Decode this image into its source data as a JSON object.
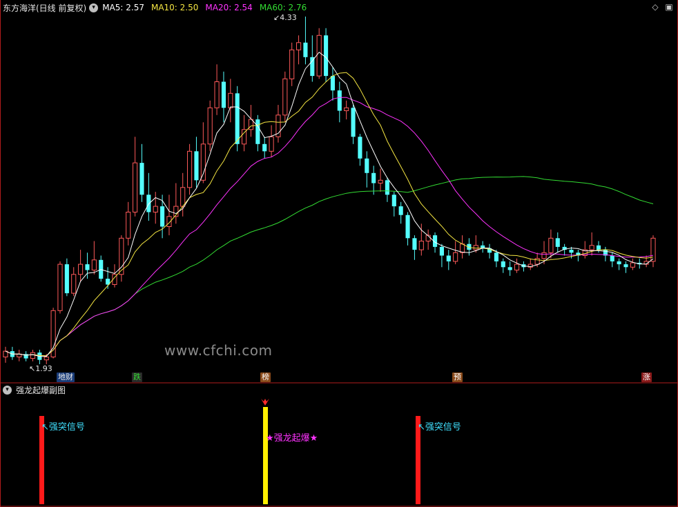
{
  "header": {
    "title": "东方海洋(日线 前复权)",
    "ma_items": [
      {
        "label": "MA5: 2.57",
        "color": "#ffffff"
      },
      {
        "label": "MA10: 2.50",
        "color": "#f5e642"
      },
      {
        "label": "MA20: 2.54",
        "color": "#ff33ff"
      },
      {
        "label": "MA60: 2.76",
        "color": "#33dd33"
      }
    ]
  },
  "top_icons": [
    "diamond-icon",
    "square-icon"
  ],
  "price_labels": {
    "high": "4.33",
    "low": "1.93"
  },
  "watermark": "www.cfchi.com",
  "event_tags": [
    {
      "text": "地财",
      "color": "#e8e8e8",
      "bg": "#1a3d7a"
    },
    {
      "text": "跌",
      "color": "#33dd33",
      "bg": "#2a2a2a"
    },
    {
      "text": "榜",
      "color": "#ffffff",
      "bg": "#8a4a1a"
    },
    {
      "text": "预",
      "color": "#ffffff",
      "bg": "#8a4a1a"
    },
    {
      "text": "涨",
      "color": "#ffffff",
      "bg": "#8a1a1a"
    }
  ],
  "sub_panel": {
    "title": "强龙起爆副图",
    "signals": [
      {
        "label": "↖强突信号",
        "color": "#ff1a1a",
        "label_color": "#40e0ff"
      },
      {
        "label": "★强龙起爆★",
        "color": "#ffee00",
        "label_color": "#ff33ff"
      },
      {
        "label": "↖强突信号",
        "color": "#ff1a1a",
        "label_color": "#40e0ff"
      }
    ]
  },
  "colors": {
    "up": "#ff5a5a",
    "down": "#54ffff",
    "ma5": "#ffffff",
    "ma10": "#f5e642",
    "ma20": "#ff33ff",
    "ma60": "#33dd33",
    "divider": "#b21c1c"
  },
  "chart_data": {
    "type": "candlestick",
    "price_max": 4.33,
    "price_min": 1.93,
    "candles": [
      [
        1.98,
        2.02,
        2.05,
        1.94
      ],
      [
        2.02,
        1.98,
        2.05,
        1.96
      ],
      [
        1.98,
        2.0,
        2.03,
        1.95
      ],
      [
        2.0,
        1.97,
        2.02,
        1.95
      ],
      [
        1.97,
        2.01,
        2.03,
        1.95
      ],
      [
        2.01,
        1.96,
        2.03,
        1.93
      ],
      [
        1.96,
        1.98,
        2.0,
        1.93
      ],
      [
        1.98,
        2.3,
        2.32,
        1.97
      ],
      [
        2.3,
        2.62,
        2.64,
        2.28
      ],
      [
        2.62,
        2.42,
        2.66,
        2.4
      ],
      [
        2.42,
        2.55,
        2.6,
        2.4
      ],
      [
        2.55,
        2.62,
        2.72,
        2.5
      ],
      [
        2.62,
        2.58,
        2.7,
        2.52
      ],
      [
        2.58,
        2.65,
        2.78,
        2.55
      ],
      [
        2.65,
        2.52,
        2.68,
        2.5
      ],
      [
        2.52,
        2.48,
        2.6,
        2.45
      ],
      [
        2.48,
        2.55,
        2.62,
        2.46
      ],
      [
        2.55,
        2.8,
        2.82,
        2.5
      ],
      [
        2.8,
        2.98,
        3.05,
        2.75
      ],
      [
        2.98,
        3.32,
        3.5,
        2.95
      ],
      [
        3.32,
        3.1,
        3.45,
        3.05
      ],
      [
        3.1,
        2.98,
        3.25,
        2.92
      ],
      [
        2.98,
        3.02,
        3.12,
        2.9
      ],
      [
        3.02,
        2.88,
        3.1,
        2.8
      ],
      [
        2.88,
        2.95,
        3.1,
        2.82
      ],
      [
        2.95,
        3.02,
        3.18,
        2.9
      ],
      [
        3.02,
        3.15,
        3.25,
        2.95
      ],
      [
        3.15,
        3.4,
        3.45,
        3.1
      ],
      [
        3.4,
        3.2,
        3.5,
        3.15
      ],
      [
        3.2,
        3.45,
        3.6,
        3.18
      ],
      [
        3.45,
        3.7,
        3.75,
        3.4
      ],
      [
        3.7,
        3.88,
        4.0,
        3.65
      ],
      [
        3.88,
        3.7,
        3.95,
        3.6
      ],
      [
        3.7,
        3.8,
        3.9,
        3.6
      ],
      [
        3.8,
        3.45,
        3.85,
        3.4
      ],
      [
        3.45,
        3.55,
        3.65,
        3.4
      ],
      [
        3.55,
        3.62,
        3.72,
        3.5
      ],
      [
        3.62,
        3.45,
        3.65,
        3.4
      ],
      [
        3.45,
        3.4,
        3.5,
        3.35
      ],
      [
        3.4,
        3.5,
        3.58,
        3.36
      ],
      [
        3.5,
        3.65,
        3.72,
        3.46
      ],
      [
        3.65,
        3.9,
        3.95,
        3.6
      ],
      [
        3.9,
        4.1,
        4.15,
        3.85
      ],
      [
        4.1,
        4.15,
        4.2,
        4.0
      ],
      [
        4.15,
        4.05,
        4.33,
        4.0
      ],
      [
        4.05,
        3.92,
        4.2,
        3.88
      ],
      [
        3.92,
        4.2,
        4.25,
        3.9
      ],
      [
        4.2,
        3.92,
        4.25,
        3.88
      ],
      [
        3.92,
        3.82,
        3.98,
        3.75
      ],
      [
        3.82,
        3.68,
        3.88,
        3.6
      ],
      [
        3.68,
        3.7,
        3.75,
        3.62
      ],
      [
        3.7,
        3.5,
        3.72,
        3.45
      ],
      [
        3.5,
        3.35,
        3.52,
        3.3
      ],
      [
        3.35,
        3.25,
        3.4,
        3.15
      ],
      [
        3.25,
        3.18,
        3.3,
        3.1
      ],
      [
        3.18,
        3.2,
        3.28,
        3.12
      ],
      [
        3.2,
        3.1,
        3.22,
        3.05
      ],
      [
        3.1,
        3.02,
        3.12,
        2.95
      ],
      [
        3.02,
        2.96,
        3.05,
        2.9
      ],
      [
        2.96,
        2.8,
        2.98,
        2.75
      ],
      [
        2.8,
        2.72,
        2.82,
        2.65
      ],
      [
        2.72,
        2.78,
        2.9,
        2.68
      ],
      [
        2.78,
        2.82,
        2.86,
        2.72
      ],
      [
        2.82,
        2.74,
        2.84,
        2.7
      ],
      [
        2.74,
        2.68,
        2.76,
        2.6
      ],
      [
        2.68,
        2.64,
        2.72,
        2.58
      ],
      [
        2.64,
        2.7,
        2.78,
        2.62
      ],
      [
        2.7,
        2.76,
        2.82,
        2.66
      ],
      [
        2.76,
        2.72,
        2.8,
        2.68
      ],
      [
        2.72,
        2.75,
        2.82,
        2.7
      ],
      [
        2.75,
        2.73,
        2.78,
        2.7
      ],
      [
        2.73,
        2.7,
        2.76,
        2.66
      ],
      [
        2.7,
        2.64,
        2.72,
        2.6
      ],
      [
        2.64,
        2.6,
        2.66,
        2.56
      ],
      [
        2.6,
        2.58,
        2.64,
        2.54
      ],
      [
        2.58,
        2.62,
        2.66,
        2.56
      ],
      [
        2.62,
        2.6,
        2.64,
        2.57
      ],
      [
        2.6,
        2.62,
        2.66,
        2.58
      ],
      [
        2.62,
        2.66,
        2.7,
        2.6
      ],
      [
        2.66,
        2.7,
        2.78,
        2.62
      ],
      [
        2.7,
        2.8,
        2.86,
        2.66
      ],
      [
        2.8,
        2.74,
        2.84,
        2.7
      ],
      [
        2.74,
        2.72,
        2.76,
        2.68
      ],
      [
        2.72,
        2.7,
        2.74,
        2.66
      ],
      [
        2.7,
        2.68,
        2.72,
        2.64
      ],
      [
        2.68,
        2.72,
        2.78,
        2.66
      ],
      [
        2.72,
        2.75,
        2.84,
        2.68
      ],
      [
        2.75,
        2.72,
        2.78,
        2.7
      ],
      [
        2.72,
        2.68,
        2.74,
        2.64
      ],
      [
        2.68,
        2.64,
        2.7,
        2.6
      ],
      [
        2.64,
        2.62,
        2.66,
        2.58
      ],
      [
        2.62,
        2.6,
        2.64,
        2.56
      ],
      [
        2.6,
        2.63,
        2.66,
        2.58
      ],
      [
        2.63,
        2.62,
        2.66,
        2.59
      ],
      [
        2.62,
        2.64,
        2.68,
        2.6
      ],
      [
        2.64,
        2.8,
        2.82,
        2.6
      ]
    ]
  }
}
